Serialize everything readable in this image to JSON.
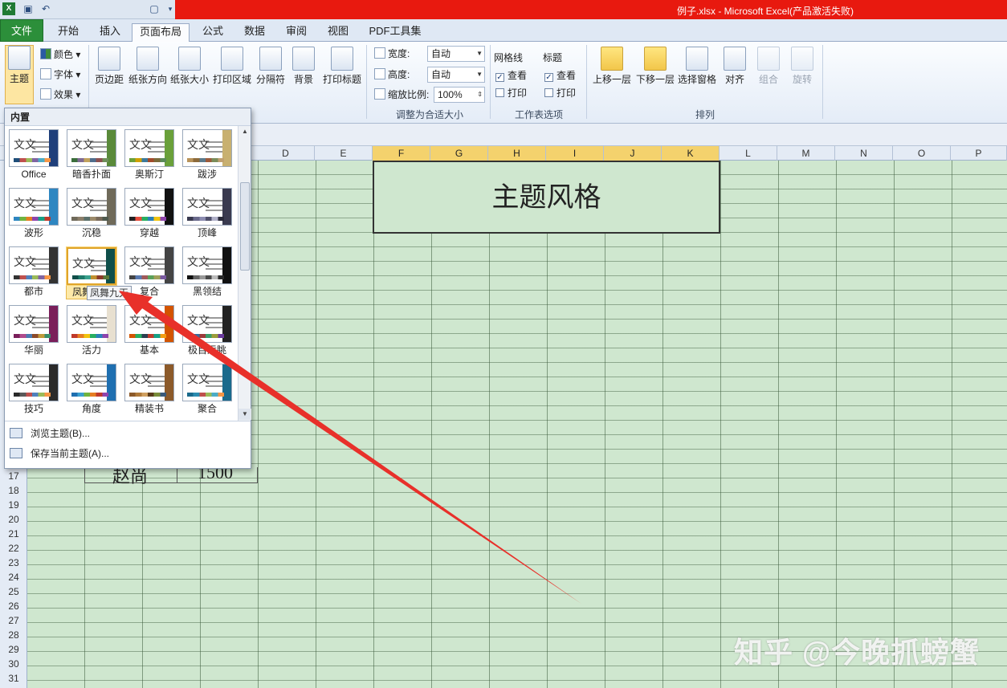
{
  "title_bar": {
    "text": "例子.xlsx - Microsoft Excel(产品激活失败)"
  },
  "tabs": [
    "文件",
    "开始",
    "插入",
    "页面布局",
    "公式",
    "数据",
    "审阅",
    "视图",
    "PDF工具集"
  ],
  "ribbon": {
    "theme_group": {
      "theme_label": "主题",
      "colors": "颜色",
      "fonts": "字体",
      "effects": "效果"
    },
    "page_setup": {
      "margins": "页边距",
      "orientation": "纸张方向",
      "size": "纸张大小",
      "print_area": "打印区域",
      "breaks": "分隔符",
      "background": "背景",
      "print_titles": "打印标题"
    },
    "scale": {
      "width_label": "宽度:",
      "width_value": "自动",
      "height_label": "高度:",
      "height_value": "自动",
      "scale_label": "缩放比例:",
      "scale_value": "100%",
      "group_label": "调整为合适大小"
    },
    "sheet_options": {
      "gridlines": "网格线",
      "headings": "标题",
      "view": "查看",
      "print": "打印",
      "group_label": "工作表选项"
    },
    "arrange": {
      "bring_forward": "上移一层",
      "send_backward": "下移一层",
      "selection_pane": "选择窗格",
      "align": "对齐",
      "group": "组合",
      "rotate": "旋转",
      "group_label": "排列"
    }
  },
  "gallery": {
    "header": "内置",
    "thumb_text": "文文",
    "themes": [
      "Office",
      "暗香扑面",
      "奥斯汀",
      "跋涉",
      "波形",
      "沉稳",
      "穿越",
      "顶峰",
      "都市",
      "凤舞九天",
      "复合",
      "黑领结",
      "华丽",
      "活力",
      "基本",
      "极目远眺",
      "技巧",
      "角度",
      "精装书",
      "聚合"
    ],
    "tooltip": "凤舞九天",
    "browse": "浏览主题(B)...",
    "save": "保存当前主题(A)..."
  },
  "sheet": {
    "columns": [
      "D",
      "E",
      "F",
      "G",
      "H",
      "I",
      "J",
      "K",
      "L",
      "M",
      "N",
      "O",
      "P"
    ],
    "rows": [
      "17",
      "18",
      "19",
      "20",
      "21",
      "22",
      "23",
      "24",
      "25",
      "26",
      "27",
      "28",
      "29",
      "30",
      "31"
    ],
    "merged_text": "主题风格",
    "row17_name": "赵尚",
    "row17_value": "1500"
  },
  "watermark": "知乎 @今晚抓螃蟹",
  "colors": {
    "file_tab": "#2c8f3a",
    "title_bar": "#e8190f",
    "sheet_bg": "#cfe7cf",
    "selected_header": "#f4d26d",
    "arrow": "#e8302a"
  }
}
